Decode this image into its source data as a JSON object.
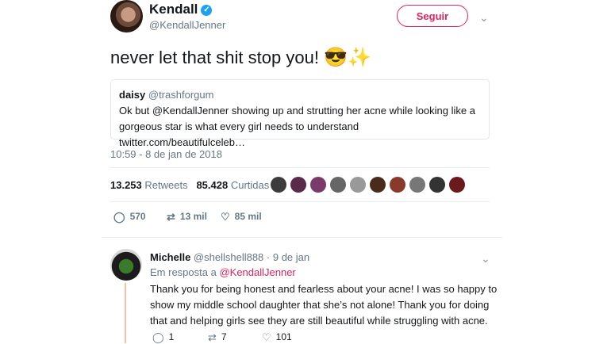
{
  "author": {
    "name": "Kendall",
    "handle": "@KendallJenner",
    "verified_mark": "✓"
  },
  "follow_label": "Seguir",
  "tweet": {
    "text": "never let that shit stop you!",
    "emoji": "😎✨"
  },
  "quote": {
    "name": "daisy",
    "handle": "@trashforgum",
    "text": "Ok but @KendallJenner showing up and strutting her acne while looking like a gorgeous star is what every girl needs to understand twitter.com/beautifulceleb…"
  },
  "timestamp": "10:59 - 8 de jan de 2018",
  "stats": {
    "retweets_count": "13.253",
    "retweets_label": "Retweets",
    "likes_count": "85.428",
    "likes_label": "Curtidas"
  },
  "liker_colors": [
    "#3c3c3c",
    "#5a2a4a",
    "#7a3a6a",
    "#666666",
    "#999999",
    "#4a2a1a",
    "#8a3a2a",
    "#777777",
    "#333333",
    "#6a1a1a"
  ],
  "actions": {
    "replies": "570",
    "retweets": "13 mil",
    "likes": "85 mil"
  },
  "reply": {
    "name": "Michelle",
    "handle": "@shellshell888",
    "date": "· 9 de jan",
    "in_reply_prefix": "Em resposta a",
    "in_reply_handle": "@KendallJenner",
    "text": "Thank you for being honest and fearless about your acne! I was so happy to show my middle school daughter that she’s not alone! Thank you for doing that and helping girls see they are still beautiful while struggling with acne.",
    "replies": "1",
    "retweets": "7",
    "likes": "101"
  },
  "icons": {
    "reply": "reply-icon",
    "retweet": "retweet-icon",
    "like": "heart-icon",
    "more": "chevron-down-icon"
  }
}
